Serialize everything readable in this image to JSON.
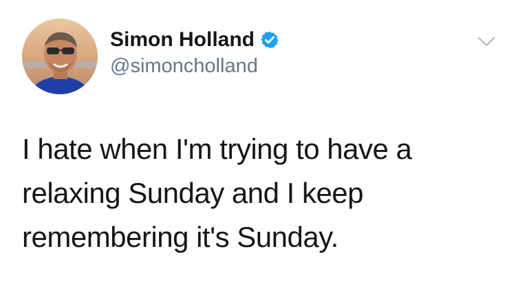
{
  "author": {
    "display_name": "Simon Holland",
    "handle": "@simoncholland",
    "verified": true,
    "avatar_icon": "profile-photo"
  },
  "tweet": {
    "lines": [
      "I hate when I'm trying to have a",
      "relaxing Sunday and I keep",
      "remembering it's Sunday."
    ]
  },
  "menu": {
    "icon": "chevron-down-icon"
  },
  "colors": {
    "name": "#14171a",
    "handle": "#657786",
    "verified_badge": "#1da1f2",
    "chevron": "#aab8c2"
  }
}
